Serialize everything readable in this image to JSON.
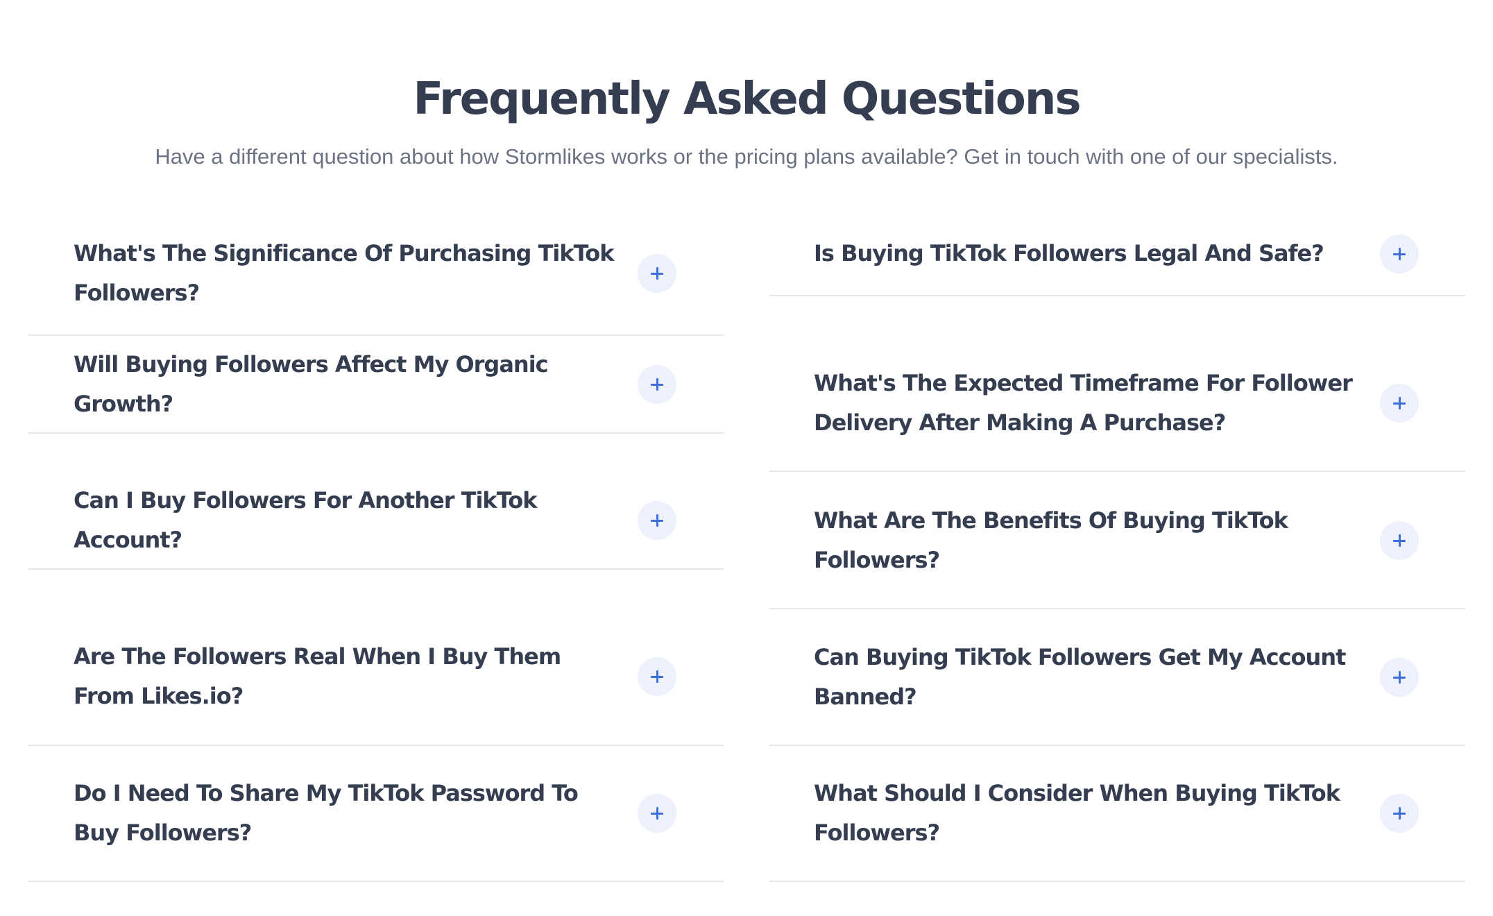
{
  "header": {
    "title": "Frequently Asked Questions",
    "subtitle": "Have a different question about how Stormlikes works or the pricing plans available? Get in touch with one of our specialists."
  },
  "colors": {
    "heading": "#343e50",
    "subtitle": "#6b7283",
    "accent": "#3f6fd8",
    "button_bg": "#edf1fc",
    "divider": "#e6e7ec"
  },
  "faq": {
    "left": [
      {
        "question": "What's The Significance Of Purchasing TikTok Followers?",
        "icon": "plus-icon"
      },
      {
        "question": "Will Buying Followers Affect My Organic Growth?",
        "icon": "plus-icon"
      },
      {
        "question": "Can I Buy Followers For Another TikTok Account?",
        "icon": "plus-icon"
      },
      {
        "question": "Are The Followers Real When I Buy Them From Likes.io?",
        "icon": "plus-icon"
      },
      {
        "question": "Do I Need To Share My TikTok Password To Buy Followers?",
        "icon": "plus-icon"
      }
    ],
    "right": [
      {
        "question": "Is Buying TikTok Followers Legal And Safe?",
        "icon": "plus-icon"
      },
      {
        "question": "What's The Expected Timeframe For Follower Delivery After Making A Purchase?",
        "icon": "plus-icon"
      },
      {
        "question": "What Are The Benefits Of Buying TikTok Followers?",
        "icon": "plus-icon"
      },
      {
        "question": "Can Buying TikTok Followers Get My Account Banned?",
        "icon": "plus-icon"
      },
      {
        "question": "What Should I Consider When Buying TikTok Followers?",
        "icon": "plus-icon"
      }
    ]
  }
}
